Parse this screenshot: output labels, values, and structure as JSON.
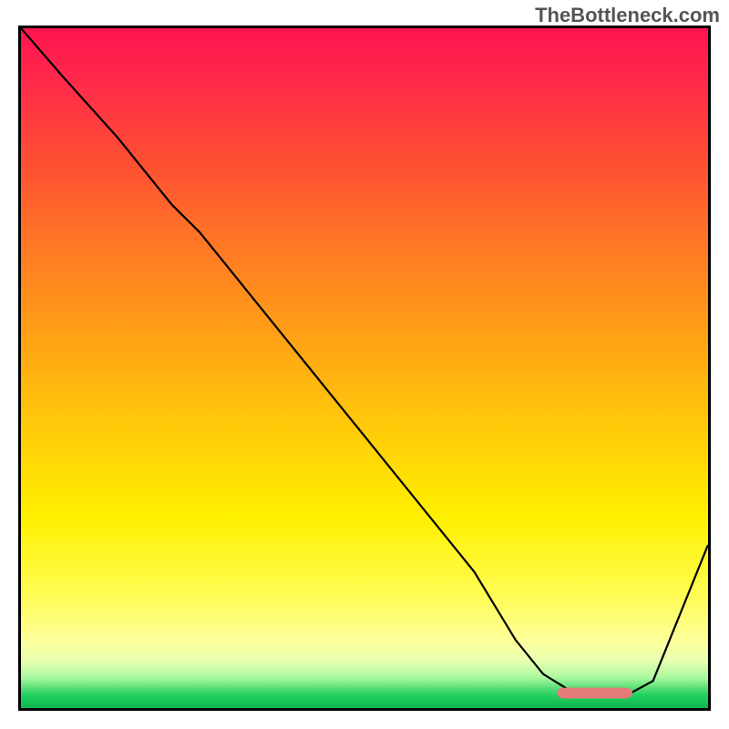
{
  "watermark": "TheBottleneck.com",
  "chart_data": {
    "type": "line",
    "title": "",
    "xlabel": "",
    "ylabel": "",
    "xlim": [
      0,
      100
    ],
    "ylim": [
      0,
      100
    ],
    "axes_visible": false,
    "background_gradient": {
      "type": "vertical",
      "stops": [
        {
          "pos": 0.0,
          "color": "#ff1450"
        },
        {
          "pos": 0.08,
          "color": "#ff2a4a"
        },
        {
          "pos": 0.2,
          "color": "#ff5033"
        },
        {
          "pos": 0.32,
          "color": "#ff7825"
        },
        {
          "pos": 0.45,
          "color": "#ffa015"
        },
        {
          "pos": 0.58,
          "color": "#ffc80a"
        },
        {
          "pos": 0.72,
          "color": "#fff000"
        },
        {
          "pos": 0.83,
          "color": "#fffc50"
        },
        {
          "pos": 0.9,
          "color": "#fdff9a"
        },
        {
          "pos": 0.93,
          "color": "#e8ffb0"
        },
        {
          "pos": 0.955,
          "color": "#aaf8a0"
        },
        {
          "pos": 0.97,
          "color": "#5ce078"
        },
        {
          "pos": 0.982,
          "color": "#1fcf5e"
        },
        {
          "pos": 1.0,
          "color": "#0fb852"
        }
      ]
    },
    "series": [
      {
        "name": "bottleneck-curve",
        "color": "#000000",
        "x": [
          0,
          6,
          14,
          22,
          26,
          34,
          42,
          50,
          58,
          66,
          72,
          76,
          80,
          84,
          88,
          92,
          96,
          100
        ],
        "values": [
          100,
          93,
          84,
          74,
          70,
          60,
          50,
          40,
          30,
          20,
          10,
          5,
          2.5,
          1.8,
          1.8,
          4,
          14,
          24
        ]
      }
    ],
    "highlight": {
      "name": "optimal-range",
      "color": "#e57b7b",
      "x_start": 78,
      "x_end": 89,
      "y": 2.2,
      "height": 1.6,
      "shape": "rounded-bar"
    }
  }
}
